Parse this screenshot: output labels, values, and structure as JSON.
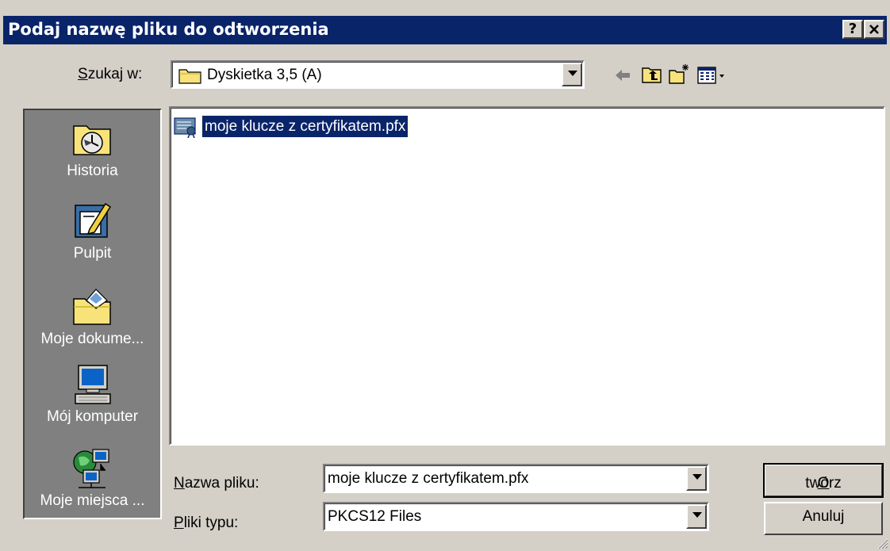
{
  "dialog": {
    "title": "Podaj nazwę pliku do odtworzenia",
    "help_button": "?",
    "close_button": "×"
  },
  "look_in": {
    "label_first": "S",
    "label_rest": "zukaj w:",
    "value": "Dyskietka 3,5 (A)",
    "icon": "folder-icon"
  },
  "toolbar": {
    "icons": [
      "back-arrow-icon",
      "up-folder-icon",
      "new-folder-icon",
      "view-menu-icon"
    ]
  },
  "places": [
    {
      "label": "Historia",
      "icon": "history-icon"
    },
    {
      "label": "Pulpit",
      "icon": "desktop-icon"
    },
    {
      "label": "Moje dokume...",
      "icon": "my-documents-icon"
    },
    {
      "label": "Mój komputer",
      "icon": "my-computer-icon"
    },
    {
      "label": "Moje miejsca ...",
      "icon": "network-places-icon"
    }
  ],
  "files": [
    {
      "name": "moje klucze z certyfikatem.pfx",
      "icon": "certificate-file-icon",
      "selected": true
    }
  ],
  "filename": {
    "label_first": "N",
    "label_rest": "azwa pliku:",
    "value": "moje klucze z certyfikatem.pfx"
  },
  "filetype": {
    "label_first": "P",
    "label_rest": "liki typu:",
    "value": "PKCS12 Files"
  },
  "buttons": {
    "open_first": "O",
    "open_rest": "twórz",
    "cancel": "Anuluj"
  },
  "colors": {
    "titlebar": "#0a246a",
    "face": "#d4d0c8",
    "selection": "#0a246a",
    "places_bg": "#808080"
  }
}
